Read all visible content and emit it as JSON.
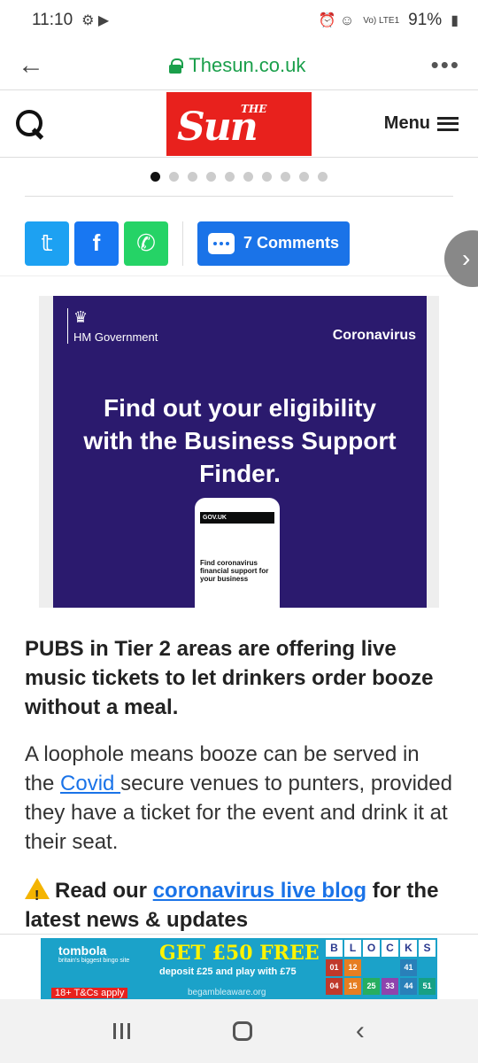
{
  "status": {
    "time": "11:10",
    "battery": "91%",
    "signal_text": "Vo) LTE1"
  },
  "browser": {
    "url": "Thesun.co.uk"
  },
  "header": {
    "logo_the": "THE",
    "logo_sun": "Sun",
    "menu_label": "Menu"
  },
  "carousel": {
    "count": 10,
    "active_index": 0
  },
  "share": {
    "comments_label": "7 Comments"
  },
  "ad": {
    "government": "HM Government",
    "label": "Coronavirus",
    "headline": "Find out your eligibility with the Business Support Finder.",
    "phone_brand": "GOV.UK",
    "phone_title": "Find coronavirus financial support for your business"
  },
  "article": {
    "lead": "PUBS in Tier 2 areas are offering live music tickets to let drinkers order booze without a meal.",
    "para_before": "A loophole means booze can be served in the ",
    "para_link": "Covid ",
    "para_after": "secure venues to punters, provided they have a ticket for the event and drink it at their seat.",
    "live_prefix": "Read our ",
    "live_link": "coronavirus live blog",
    "live_suffix": " for the latest news & updates"
  },
  "banner": {
    "brand": "tombola",
    "brand_sub": "britain's biggest bingo site",
    "promo": "GET £50 FREE",
    "deposit": "deposit £25 and play with £75",
    "gamble": "begambleaware.org",
    "tcs": "18+ T&Cs apply",
    "blocks_title": [
      "B",
      "L",
      "O",
      "C",
      "K",
      "S"
    ],
    "blocks_numbers": [
      "01",
      "12",
      "",
      "",
      "41",
      "",
      "04",
      "15",
      "25",
      "33",
      "44",
      "51"
    ]
  }
}
